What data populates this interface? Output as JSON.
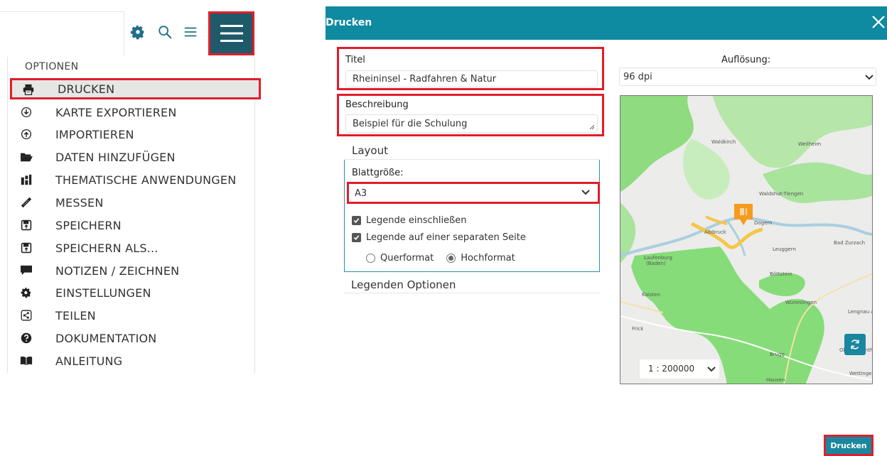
{
  "menu": {
    "title": "OPTIONEN",
    "items": [
      {
        "label": "DRUCKEN",
        "icon": "printer-icon",
        "active": true
      },
      {
        "label": "KARTE EXPORTIEREN",
        "icon": "circle-arrow-down-icon"
      },
      {
        "label": "IMPORTIEREN",
        "icon": "circle-arrow-up-icon"
      },
      {
        "label": "DATEN HINZUFÜGEN",
        "icon": "folder-open-icon"
      },
      {
        "label": "THEMATISCHE ANWENDUNGEN",
        "icon": "thematic-apps-icon"
      },
      {
        "label": "MESSEN",
        "icon": "ruler-icon"
      },
      {
        "label": "SPEICHERN",
        "icon": "save-icon"
      },
      {
        "label": "SPEICHERN ALS...",
        "icon": "save-as-icon"
      },
      {
        "label": "NOTIZEN / ZEICHNEN",
        "icon": "comment-icon"
      },
      {
        "label": "EINSTELLUNGEN",
        "icon": "gear-icon"
      },
      {
        "label": "TEILEN",
        "icon": "share-icon"
      },
      {
        "label": "DOKUMENTATION",
        "icon": "question-icon"
      },
      {
        "label": "ANLEITUNG",
        "icon": "book-icon"
      }
    ]
  },
  "dialog": {
    "title": "Drucken",
    "title_label": "Titel",
    "title_value": "Rheininsel - Radfahren & Natur",
    "description_label": "Beschreibung",
    "description_value": "Beispiel für die Schulung",
    "layout_title": "Layout",
    "sheet_size_label": "Blattgröße:",
    "sheet_size_value": "A3",
    "include_legend_label": "Legende einschließen",
    "legend_separate_label": "Legende auf einer separaten Seite",
    "landscape_label": "Querformat",
    "portrait_label": "Hochformat",
    "legend_options_title": "Legenden Optionen",
    "resolution_label": "Auflösung:",
    "resolution_value": "96 dpi",
    "scale_value": "1 : 200000",
    "print_button": "Drucken"
  },
  "map_labels": {
    "waldkirch": "Waldkirch",
    "weilheim": "Weilheim",
    "waldshut": "Waldshut-Tiengen",
    "albbruck": "Albbruck",
    "dogern": "Dogern",
    "leuggern": "Leuggern",
    "bad_zurzach": "Bad Zurzach",
    "laufenburg": "Laufenburg",
    "laufenburg_sub": "(Baden)",
    "bottstein": "Böttstein",
    "kaisten": "Kaisten",
    "wurenlingen": "Würenlingen",
    "lengnau": "Lengnau AG",
    "frick": "Frick",
    "obersiggenthal": "Obersiggenthal",
    "brugg": "Brugg",
    "wettingen": "Wettingen",
    "hausen": "Hausen"
  },
  "colors": {
    "header": "#0e8aa1",
    "highlight": "#e01e2a",
    "menu_button": "#1e5a6a",
    "forest": "#7fd672",
    "marker": "#f59b1e"
  }
}
